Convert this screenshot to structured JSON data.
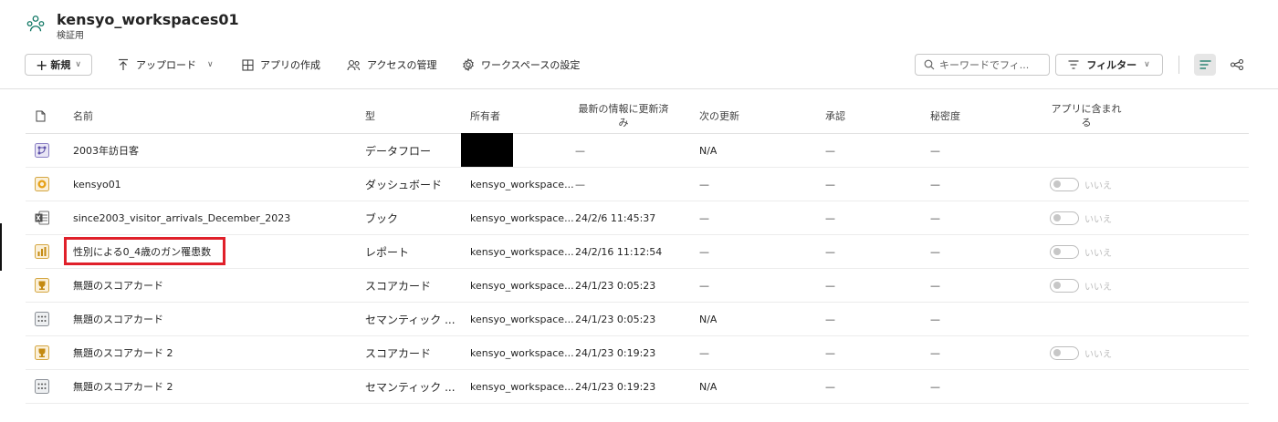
{
  "workspace": {
    "title": "kensyo_workspaces01",
    "subtitle": "検証用",
    "icon": "workspace-people-icon"
  },
  "toolbar": {
    "new_label": "新規",
    "upload_label": "アップロード",
    "create_app_label": "アプリの作成",
    "manage_access_label": "アクセスの管理",
    "workspace_settings_label": "ワークスペースの設定",
    "search_placeholder": "キーワードでフィ...",
    "filter_label": "フィルター"
  },
  "columns": {
    "name": "名前",
    "type": "型",
    "owner": "所有者",
    "refreshed_line1": "最新の情報に更新済",
    "refreshed_line2": "み",
    "next_refresh": "次の更新",
    "endorsement": "承認",
    "sensitivity": "秘密度",
    "included_line1": "アプリに含まれ",
    "included_line2": "る"
  },
  "rows": [
    {
      "icon": "dataflow-icon",
      "name": "2003年訪日客",
      "type": "データフロー",
      "owner": "",
      "refreshed": "—",
      "next": "N/A",
      "endorse": "—",
      "sens": "—",
      "toggle": ""
    },
    {
      "icon": "dashboard-icon",
      "name": "kensyo01",
      "type": "ダッシュボード",
      "owner": "kensyo_workspace...",
      "refreshed": "—",
      "next": "—",
      "endorse": "—",
      "sens": "—",
      "toggle": "いいえ"
    },
    {
      "icon": "excel-workbook-icon",
      "name": "since2003_visitor_arrivals_December_2023",
      "type": "ブック",
      "owner": "kensyo_workspace...",
      "refreshed": "24/2/6 11:45:37",
      "next": "—",
      "endorse": "—",
      "sens": "—",
      "toggle": "いいえ"
    },
    {
      "icon": "report-icon",
      "name": "性別による0_4歳のガン罹患数",
      "type": "レポート",
      "owner": "kensyo_workspace...",
      "refreshed": "24/2/16 11:12:54",
      "next": "—",
      "endorse": "—",
      "sens": "—",
      "toggle": "いいえ"
    },
    {
      "icon": "scorecard-icon",
      "name": "無題のスコアカード",
      "type": "スコアカード",
      "owner": "kensyo_workspace...",
      "refreshed": "24/1/23 0:05:23",
      "next": "—",
      "endorse": "—",
      "sens": "—",
      "toggle": "いいえ"
    },
    {
      "icon": "semantic-model-icon",
      "name": "無題のスコアカード",
      "type": "セマンティック ...",
      "owner": "kensyo_workspace...",
      "refreshed": "24/1/23 0:05:23",
      "next": "N/A",
      "endorse": "—",
      "sens": "—",
      "toggle": ""
    },
    {
      "icon": "scorecard-icon",
      "name": "無題のスコアカード 2",
      "type": "スコアカード",
      "owner": "kensyo_workspace...",
      "refreshed": "24/1/23 0:19:23",
      "next": "—",
      "endorse": "—",
      "sens": "—",
      "toggle": "いいえ"
    },
    {
      "icon": "semantic-model-icon",
      "name": "無題のスコアカード 2",
      "type": "セマンティック ...",
      "owner": "kensyo_workspace...",
      "refreshed": "24/1/23 0:19:23",
      "next": "N/A",
      "endorse": "—",
      "sens": "—",
      "toggle": ""
    }
  ],
  "colors": {
    "accent": "#117865",
    "highlight_border": "#e0202a",
    "redaction": "#000000"
  }
}
